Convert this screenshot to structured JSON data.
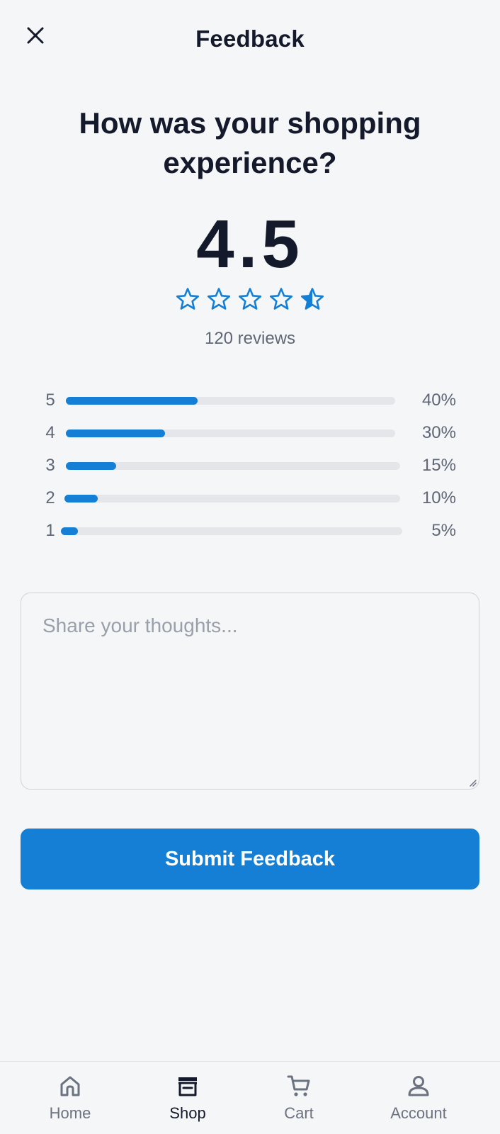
{
  "header": {
    "title": "Feedback",
    "close_icon": "close-icon"
  },
  "question": "How was your shopping experience?",
  "rating": {
    "score": "4.5",
    "stars_value": 4.5,
    "stars_max": 5,
    "star_color": "#157fd6",
    "reviews_label": "120 reviews"
  },
  "distribution": [
    {
      "label": "5",
      "percent_label": "40%",
      "fraction": 0.4
    },
    {
      "label": "4",
      "percent_label": "30%",
      "fraction": 0.3
    },
    {
      "label": "3",
      "percent_label": "15%",
      "fraction": 0.15
    },
    {
      "label": "2",
      "percent_label": "10%",
      "fraction": 0.1
    },
    {
      "label": "1",
      "percent_label": "5%",
      "fraction": 0.05
    }
  ],
  "feedback_input": {
    "value": "",
    "placeholder": "Share your thoughts..."
  },
  "submit_label": "Submit Feedback",
  "colors": {
    "accent": "#157fd6",
    "text": "#141a2b",
    "muted": "#5f6675",
    "background": "#f5f6f8"
  },
  "bottom_nav": {
    "active": "Shop",
    "items": [
      {
        "label": "Home",
        "icon": "home-icon"
      },
      {
        "label": "Shop",
        "icon": "store-icon"
      },
      {
        "label": "Cart",
        "icon": "cart-icon"
      },
      {
        "label": "Account",
        "icon": "account-icon"
      }
    ]
  }
}
